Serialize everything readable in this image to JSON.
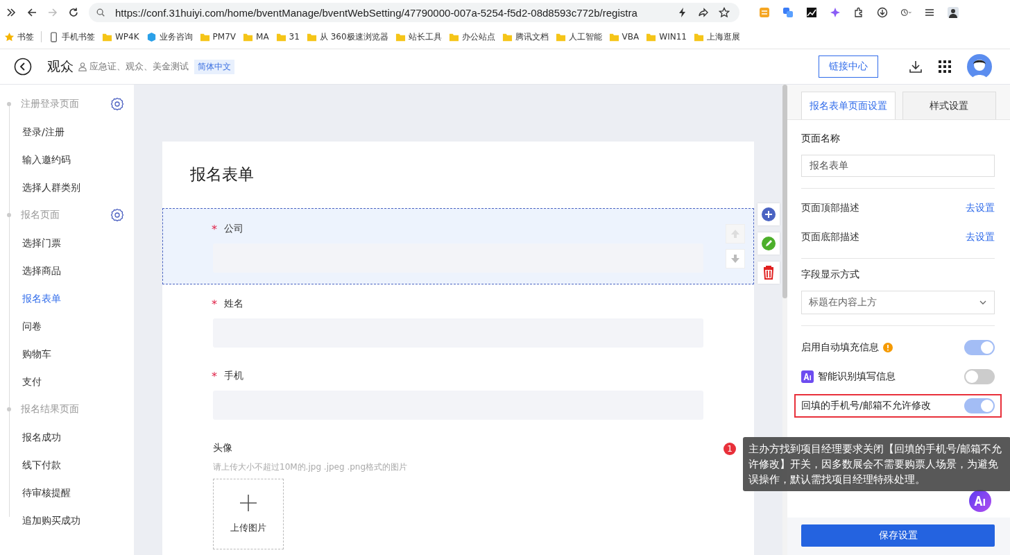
{
  "browser": {
    "url": "https://conf.31huiyi.com/home/bventManage/bventWebSetting/47790000-007a-5254-f5d2-08d8593c772b/registra",
    "bookmarks": [
      {
        "label": "书签",
        "kind": "star"
      },
      {
        "label": "手机书签",
        "kind": "phone"
      },
      {
        "label": "WP4K",
        "kind": "folder"
      },
      {
        "label": "业务咨询",
        "kind": "cube"
      },
      {
        "label": "PM7V",
        "kind": "folder"
      },
      {
        "label": "MA",
        "kind": "folder"
      },
      {
        "label": "31",
        "kind": "folder"
      },
      {
        "label": "从 360极速浏览器",
        "kind": "folder"
      },
      {
        "label": "站长工具",
        "kind": "folder"
      },
      {
        "label": "办公站点",
        "kind": "folder"
      },
      {
        "label": "腾讯文档",
        "kind": "folder"
      },
      {
        "label": "人工智能",
        "kind": "folder"
      },
      {
        "label": "VBA",
        "kind": "folder"
      },
      {
        "label": "WIN11",
        "kind": "folder"
      },
      {
        "label": "上海逛展",
        "kind": "folder"
      }
    ]
  },
  "header": {
    "title": "观众",
    "subtitle": "应急证、观众、美金测试",
    "language_tag": "简体中文",
    "link_button": "链接中心"
  },
  "sidebar": {
    "sections": [
      {
        "title": "注册登录页面",
        "has_settings": true,
        "items": [
          {
            "label": "登录/注册",
            "selected": false
          },
          {
            "label": "输入邀约码",
            "selected": false
          },
          {
            "label": "选择人群类别",
            "selected": false
          }
        ]
      },
      {
        "title": "报名页面",
        "has_settings": true,
        "items": [
          {
            "label": "选择门票",
            "selected": false
          },
          {
            "label": "选择商品",
            "selected": false
          },
          {
            "label": "报名表单",
            "selected": true
          },
          {
            "label": "问卷",
            "selected": false
          },
          {
            "label": "购物车",
            "selected": false
          },
          {
            "label": "支付",
            "selected": false
          }
        ]
      },
      {
        "title": "报名结果页面",
        "has_settings": false,
        "items": [
          {
            "label": "报名成功",
            "selected": false
          },
          {
            "label": "线下付款",
            "selected": false
          },
          {
            "label": "待审核提醒",
            "selected": false
          },
          {
            "label": "追加购买成功",
            "selected": false
          }
        ]
      }
    ]
  },
  "form": {
    "title": "报名表单",
    "fields": [
      {
        "kind": "input",
        "label": "公司",
        "required_mark": "*",
        "selected": true
      },
      {
        "kind": "input",
        "label": "姓名",
        "required_mark": "*",
        "selected": false
      },
      {
        "kind": "input",
        "label": "手机",
        "required_mark": "*",
        "selected": false
      },
      {
        "kind": "upload",
        "label": "头像",
        "selected": false,
        "hint": "请上传大小不超过10M的.jpg .jpeg .png格式的图片",
        "upload_label": "上传图片"
      }
    ]
  },
  "panel": {
    "tabs": [
      {
        "label": "报名表单页面设置",
        "selected": true
      },
      {
        "label": "样式设置",
        "selected": false
      }
    ],
    "page_name_label": "页面名称",
    "page_name_value": "报名表单",
    "links": [
      {
        "label": "页面顶部描述",
        "action": "去设置"
      },
      {
        "label": "页面底部描述",
        "action": "去设置"
      }
    ],
    "display_label": "字段显示方式",
    "display_value": "标题在内容上方",
    "switches": [
      {
        "label": "启用自动填充信息",
        "on": true,
        "kind": "warning",
        "highlighted": false
      },
      {
        "label": "智能识别填写信息",
        "on": false,
        "kind": "ai",
        "highlighted": false
      },
      {
        "label": "回填的手机号/邮箱不允许修改",
        "on": true,
        "kind": "plain",
        "highlighted": true
      }
    ],
    "save_button": "保存设置"
  },
  "tooltip": {
    "badge": "1",
    "text": "主办方找到项目经理要求关闭【回填的手机号/邮箱不允许修改】开关，因多数展会不需要购票人场景，为避免误操作，默认需找项目经理特殊处理。"
  }
}
